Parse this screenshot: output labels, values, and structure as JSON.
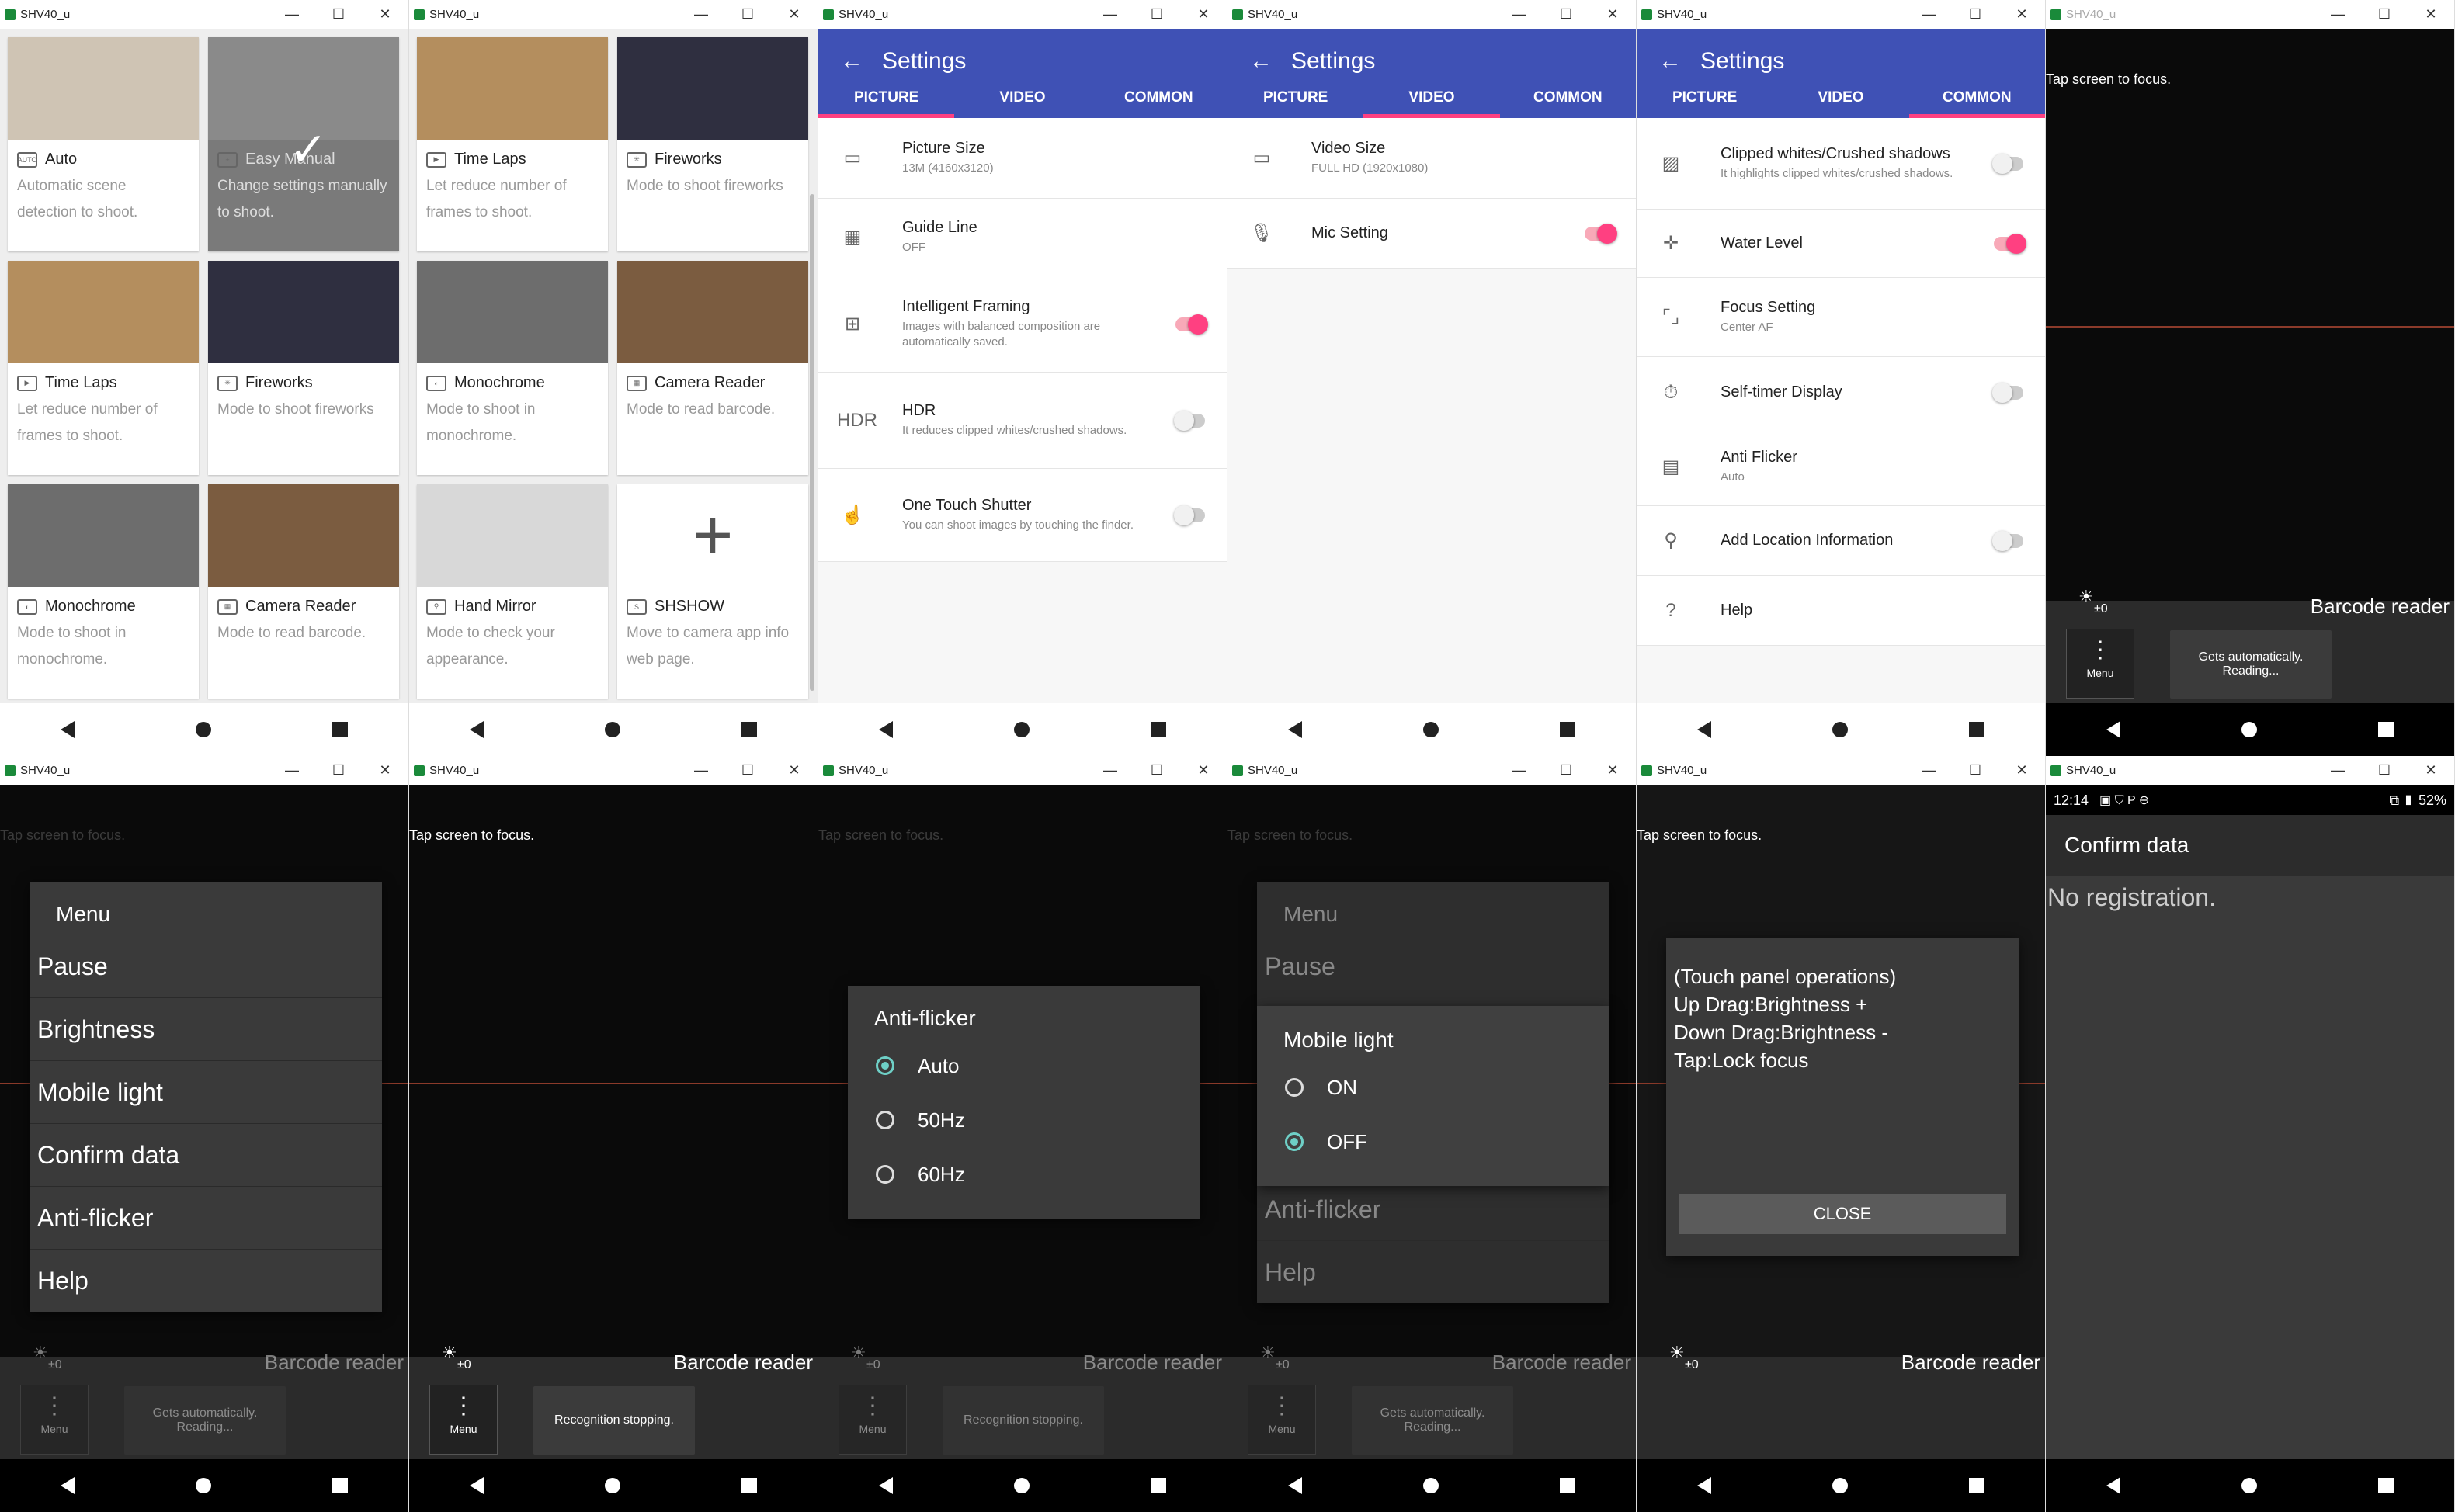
{
  "window": {
    "title": "SHV40_u",
    "minimize": "—",
    "maximize": "☐",
    "close": "✕"
  },
  "nav": {
    "back": "back",
    "home": "home",
    "recent": "recent"
  },
  "modes_page1": [
    {
      "icon": "AUTO",
      "name": "Auto",
      "desc": "Automatic scene detection to shoot.",
      "img": "#cfc4b4"
    },
    {
      "icon": "+",
      "name": "Easy Manual",
      "desc": "Change settings manually to shoot.",
      "img": "#8a8a8a",
      "selected": true
    },
    {
      "icon": "▶",
      "name": "Time Laps",
      "desc": "Let reduce number of frames to shoot.",
      "img": "#b48e5e"
    },
    {
      "icon": "✳",
      "name": "Fireworks",
      "desc": "Mode to shoot fireworks",
      "img": "#2f2f40"
    },
    {
      "icon": "◐",
      "name": "Monochrome",
      "desc": "Mode to shoot in monochrome.",
      "img": "#6d6d6d"
    },
    {
      "icon": "▦",
      "name": "Camera Reader",
      "desc": "Mode to read barcode.",
      "img": "#7b5c40"
    }
  ],
  "modes_page2": [
    {
      "icon": "▶",
      "name": "Time Laps",
      "desc": "Let reduce number of frames to shoot.",
      "img": "#b48e5e"
    },
    {
      "icon": "✳",
      "name": "Fireworks",
      "desc": "Mode to shoot fireworks",
      "img": "#2f2f40"
    },
    {
      "icon": "◐",
      "name": "Monochrome",
      "desc": "Mode to shoot in monochrome.",
      "img": "#6d6d6d"
    },
    {
      "icon": "▦",
      "name": "Camera Reader",
      "desc": "Mode to read barcode.",
      "img": "#7b5c40"
    },
    {
      "icon": "⚲",
      "name": "Hand Mirror",
      "desc": "Mode to check your appearance.",
      "img": "#d8d8d8"
    },
    {
      "icon": "S",
      "name": "SHSHOW",
      "desc": "Move to camera app info web page.",
      "img": "#ffffff"
    }
  ],
  "settings": {
    "title": "Settings",
    "tabs": [
      "PICTURE",
      "VIDEO",
      "COMMON"
    ],
    "picture": [
      {
        "icon": "▭",
        "title": "Picture Size",
        "sub": "13M (4160x3120)"
      },
      {
        "icon": "▦",
        "title": "Guide Line",
        "sub": "OFF"
      },
      {
        "icon": "⊞",
        "title": "Intelligent Framing",
        "sub": "Images with balanced composition are automatically saved.",
        "toggle": "on"
      },
      {
        "icon": "HDR",
        "title": "HDR",
        "sub": "It reduces clipped whites/crushed shadows.",
        "toggle": "off"
      },
      {
        "icon": "☝",
        "title": "One Touch Shutter",
        "sub": "You can shoot images by touching the finder.",
        "toggle": "off"
      }
    ],
    "video": [
      {
        "icon": "▭",
        "title": "Video Size",
        "sub": "FULL HD (1920x1080)"
      },
      {
        "icon": "🎙",
        "title": "Mic Setting",
        "sub": "",
        "toggle": "on"
      }
    ],
    "common": [
      {
        "icon": "▨",
        "title": "Clipped whites/Crushed shadows",
        "sub": "It highlights clipped whites/crushed shadows.",
        "toggle": "off"
      },
      {
        "icon": "✛",
        "title": "Water Level",
        "sub": "",
        "toggle": "on"
      },
      {
        "icon": "⌜⌟",
        "title": "Focus Setting",
        "sub": "Center AF"
      },
      {
        "icon": "⏱",
        "title": "Self-timer Display",
        "sub": "",
        "toggle": "off"
      },
      {
        "icon": "▤",
        "title": "Anti Flicker",
        "sub": "Auto"
      },
      {
        "icon": "⚲",
        "title": "Add Location Information",
        "sub": "",
        "toggle": "off"
      },
      {
        "icon": "?",
        "title": "Help",
        "sub": ""
      }
    ]
  },
  "camera": {
    "focus_hint": "Tap screen to focus.",
    "barcode_label": "Barcode reader",
    "brightness_label": "±0",
    "menu_label": "Menu",
    "status_reading": "Gets automatically. Reading...",
    "status_stopping": "Recognition stopping."
  },
  "menu": {
    "title": "Menu",
    "items": [
      "Pause",
      "Brightness",
      "Mobile light",
      "Confirm data",
      "Anti-flicker",
      "Help"
    ]
  },
  "anti_flicker": {
    "title": "Anti-flicker",
    "options": [
      "Auto",
      "50Hz",
      "60Hz"
    ],
    "selected": 0
  },
  "mobile_light": {
    "title": "Mobile light",
    "options": [
      "ON",
      "OFF"
    ],
    "selected": 1
  },
  "touch_help": {
    "lines": [
      "(Touch panel operations)",
      "Up Drag:Brightness +",
      "Down Drag:Brightness -",
      "Tap:Lock focus"
    ],
    "close": "CLOSE"
  },
  "confirm": {
    "time": "12:14",
    "battery": "52%",
    "title": "Confirm data",
    "body": "No registration."
  }
}
